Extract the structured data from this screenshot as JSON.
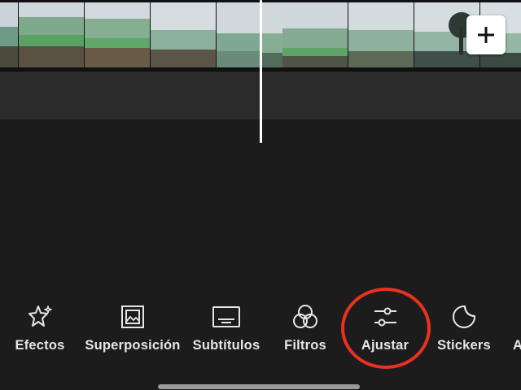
{
  "timeline": {
    "add_clip_icon": "plus-icon"
  },
  "toolbar": {
    "items": [
      {
        "label": "Efectos",
        "icon": "sparkle-star-icon"
      },
      {
        "label": "Superposición",
        "icon": "picture-overlay-icon"
      },
      {
        "label": "Subtítulos",
        "icon": "subtitles-icon"
      },
      {
        "label": "Filtros",
        "icon": "filter-circles-icon"
      },
      {
        "label": "Ajustar",
        "icon": "sliders-icon"
      },
      {
        "label": "Stickers",
        "icon": "sticker-icon"
      },
      {
        "label": "A",
        "icon": ""
      }
    ],
    "highlighted_item": "Ajustar"
  },
  "colors": {
    "background": "#1c1c1c",
    "highlight": "#e8321e",
    "label": "#e6e6e6"
  }
}
